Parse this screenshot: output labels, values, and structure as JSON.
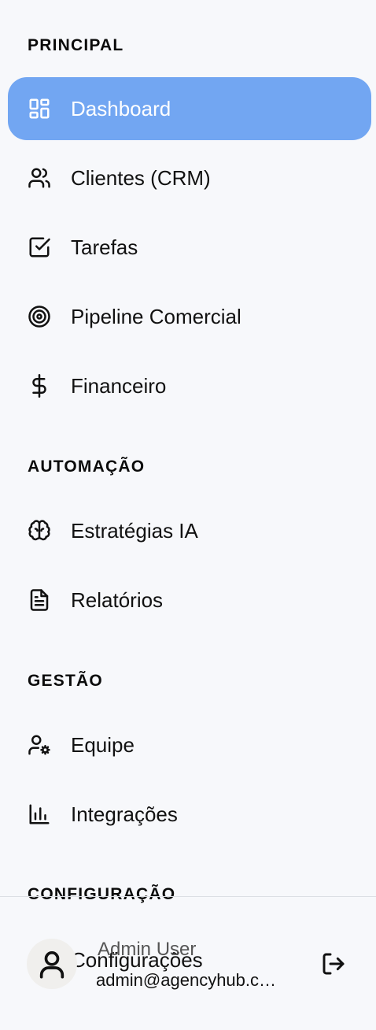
{
  "sections": {
    "principal": "PRINCIPAL",
    "automacao": "AUTOMAÇÃO",
    "gestao": "GESTÃO",
    "configuracao": "CONFIGURAÇÃO"
  },
  "nav": {
    "dashboard": {
      "label": "Dashboard",
      "icon": "layout-grid-icon",
      "active": true
    },
    "clientes": {
      "label": "Clientes (CRM)",
      "icon": "users-icon"
    },
    "tarefas": {
      "label": "Tarefas",
      "icon": "check-square-icon"
    },
    "pipeline": {
      "label": "Pipeline Comercial",
      "icon": "target-icon"
    },
    "financeiro": {
      "label": "Financeiro",
      "icon": "dollar-sign-icon"
    },
    "estrategias": {
      "label": "Estratégias IA",
      "icon": "brain-icon"
    },
    "relatorios": {
      "label": "Relatórios",
      "icon": "file-text-icon"
    },
    "equipe": {
      "label": "Equipe",
      "icon": "user-cog-icon"
    },
    "integracoes": {
      "label": "Integrações",
      "icon": "bar-chart-icon"
    },
    "configuracoes": {
      "label": "Configurações",
      "icon": "settings-icon"
    }
  },
  "user": {
    "name": "Admin User",
    "email": "admin@agencyhub.c…"
  },
  "colors": {
    "active_bg": "#72a6f2",
    "background": "#f7f8fb"
  }
}
